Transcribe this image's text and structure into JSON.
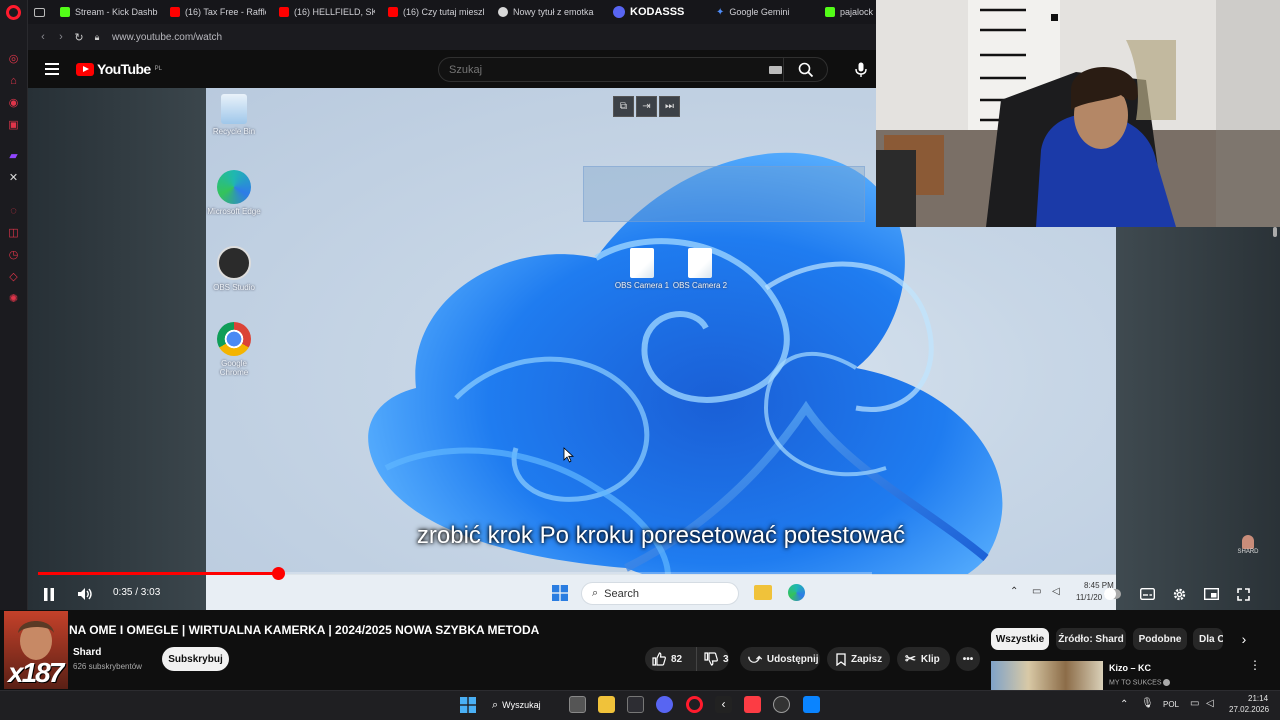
{
  "browser": {
    "tabs": [
      {
        "label": "Stream - Kick Dashb",
        "color": "#53fc18"
      },
      {
        "label": "(16) Tax Free - Raffle",
        "color": "#ff0000"
      },
      {
        "label": "(16) HELLFIELD, SKO",
        "color": "#ff0000"
      },
      {
        "label": "(16) Czy tutaj mieszk",
        "color": "#ff0000"
      },
      {
        "label": "Nowy tytuł z emotka",
        "color": "#d8d8d8"
      },
      {
        "label": "KODASSS",
        "color": "#5865f2"
      },
      {
        "label": "Google Gemini",
        "color": "#4f8cf7"
      },
      {
        "label": "pajalock S",
        "color": "#53fc18"
      }
    ],
    "url": "www.youtube.com/watch"
  },
  "youtube": {
    "logo_text": "YouTube",
    "region": "PL",
    "search_placeholder": "Szukaj"
  },
  "player": {
    "desktop_icons": [
      {
        "label": "Recycle Bin"
      },
      {
        "label": "Microsoft Edge"
      },
      {
        "label": "OBS Studio"
      },
      {
        "label": "Google Chrome"
      },
      {
        "label": "OBS Camera 1"
      },
      {
        "label": "OBS Camera 2"
      }
    ],
    "subtitle": "zrobić krok Po kroku poresetować potestować",
    "win_search": "Search",
    "win_clock": "8:45 PM",
    "win_date": "11/1/20",
    "time_display": "0:35 / 3:03",
    "progress_fraction": 0.2874,
    "watermark": "SHARD"
  },
  "video": {
    "title": "NA OME I OMEGLE | WIRTUALNA KAMERKA | 2024/2025 NOWA SZYBKA METODA",
    "channel": "Shard",
    "subscribers": "626 subskrybentów",
    "subscribe_label": "Subskrybuj",
    "likes": "82",
    "dislikes": "3",
    "share_label": "Udostępnij",
    "save_label": "Zapisz",
    "clip_label": "Klip",
    "overlay_text": "x187"
  },
  "filter_chips": [
    {
      "label": "Wszystkie",
      "selected": true
    },
    {
      "label": "Źródło: Shard",
      "selected": false
    },
    {
      "label": "Podobne",
      "selected": false
    },
    {
      "label": "Dla C",
      "selected": false
    }
  ],
  "recommendation": {
    "title": "Kizo – KC",
    "channel": "MY TO SUKCES"
  },
  "taskbar": {
    "search_label": "Wyszukaj",
    "lang": "POL",
    "time": "21:14",
    "date": "27.02.2026"
  }
}
